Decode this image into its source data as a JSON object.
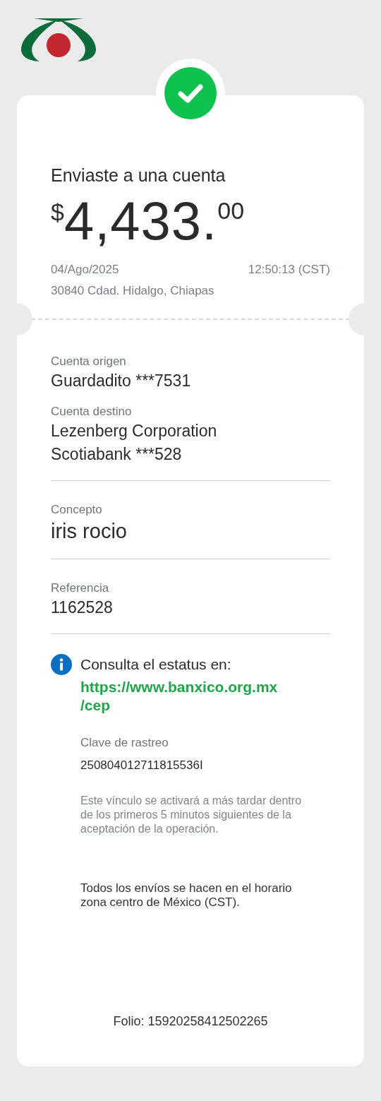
{
  "receipt": {
    "title": "Enviaste a una cuenta",
    "amount": {
      "currency": "$",
      "integer": "4,433.",
      "cents": "00"
    },
    "date": "04/Ago/2025",
    "time": "12:50:13 (CST)",
    "location": "30840 Cdad. Hidalgo, Chiapas"
  },
  "sections": [
    {
      "fields": [
        {
          "label": "Cuenta origen",
          "lines": [
            "Guardadito ***7531"
          ]
        },
        {
          "label": "Cuenta destino",
          "lines": [
            "Lezenberg Corporation",
            "Scotiabank ***528"
          ]
        }
      ]
    },
    {
      "fields": [
        {
          "label": "Concepto",
          "lines": [
            "iris rocio"
          ],
          "kind": "large"
        }
      ]
    },
    {
      "fields": [
        {
          "label": "Referencia",
          "lines": [
            "1162528"
          ]
        }
      ]
    }
  ],
  "info": {
    "text": "Consulta el estatus en:",
    "link_lines": [
      "https://www.banxico.org.mx",
      "/cep"
    ],
    "tracking_label": "Clave de rastreo",
    "tracking_value": "250804012711815536I",
    "note": "Este vínculo se activará a más tardar dentro de los primeros 5 minutos siguientes de la aceptación de la operación.",
    "timezone_note": "Todos los envíos se hacen en el horario zona centro de México (CST)."
  },
  "folio": "Folio: 15920258412502265"
}
